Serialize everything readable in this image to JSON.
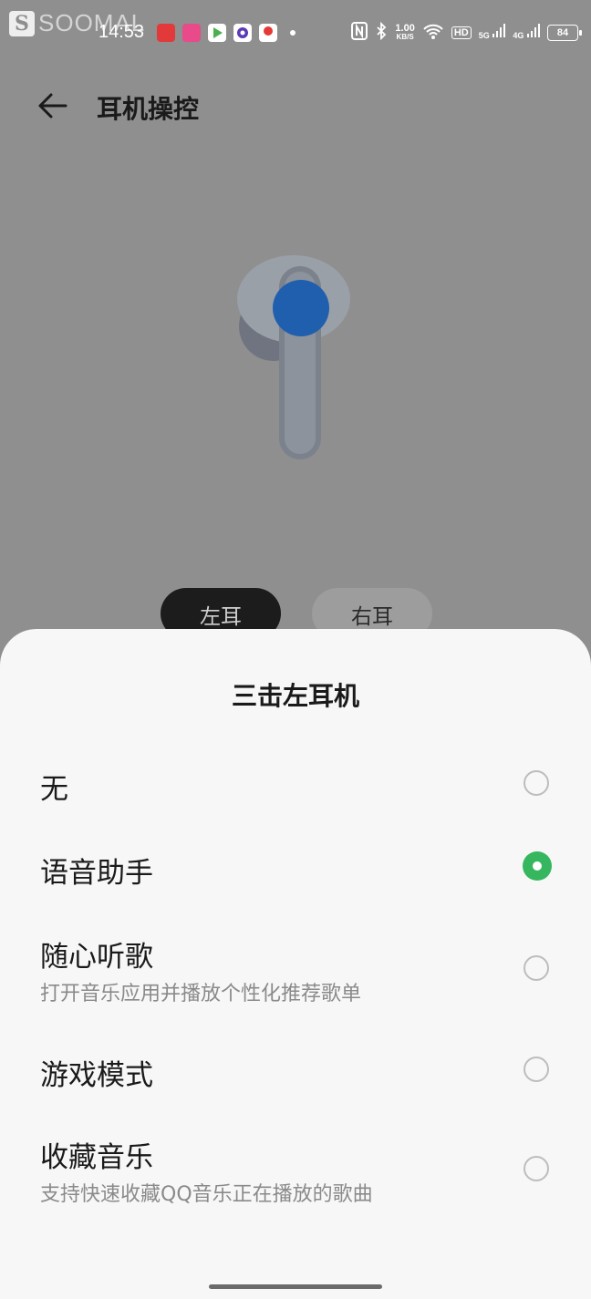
{
  "status_bar": {
    "watermark": "SOOMAL",
    "time": "14:53",
    "net_speed_value": "1.00",
    "net_speed_unit": "KB/S",
    "hd_label": "HD",
    "signal_5g": "5G",
    "signal_4g": "4G",
    "battery": "84"
  },
  "header": {
    "title": "耳机操控"
  },
  "ear_toggle": {
    "left_label": "左耳",
    "right_label": "右耳",
    "selected": "左耳"
  },
  "sheet": {
    "title": "三击左耳机",
    "options": [
      {
        "label": "无",
        "description": "",
        "selected": false
      },
      {
        "label": "语音助手",
        "description": "",
        "selected": true
      },
      {
        "label": "随心听歌",
        "description": "打开音乐应用并播放个性化推荐歌单",
        "selected": false
      },
      {
        "label": "游戏模式",
        "description": "",
        "selected": false
      },
      {
        "label": "收藏音乐",
        "description": "支持快速收藏QQ音乐正在播放的歌曲",
        "selected": false
      }
    ]
  },
  "colors": {
    "accent_green": "#36b65f",
    "overlay_gray": "#8f8f8f",
    "touch_blue": "#1f5fae"
  }
}
